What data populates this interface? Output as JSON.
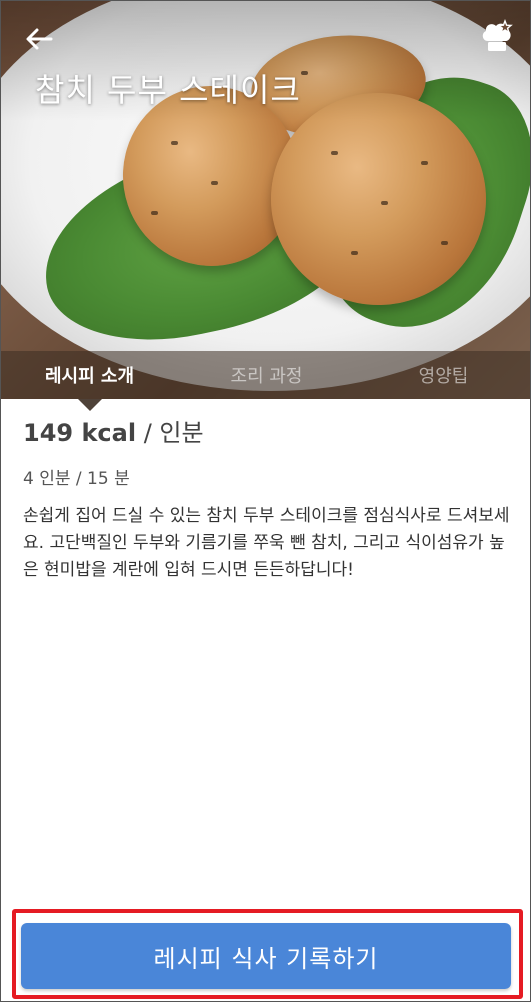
{
  "header": {
    "title": "참치 두부 스테이크",
    "back_icon": "arrow-left-icon",
    "chef_icon": "chef-hat-star-icon"
  },
  "tabs": [
    {
      "label": "레시피 소개",
      "active": true
    },
    {
      "label": "조리 과정",
      "active": false
    },
    {
      "label": "영양팁",
      "active": false
    }
  ],
  "info": {
    "kcal": "149 kcal",
    "per": " / 인분",
    "servings": "4 인분 / 15 분",
    "description": "손쉽게 집어 드실 수 있는 참치 두부 스테이크를 점심식사로 드셔보세요. 고단백질인 두부와 기름기를 쭈욱 뺀 참치, 그리고 식이섬유가 높은 현미밥을 계란에 입혀 드시면 든든하답니다!"
  },
  "actions": {
    "record_label": "레시피 식사 기록하기"
  },
  "colors": {
    "button": "#4a86d8",
    "highlight_border": "#e51b23"
  }
}
